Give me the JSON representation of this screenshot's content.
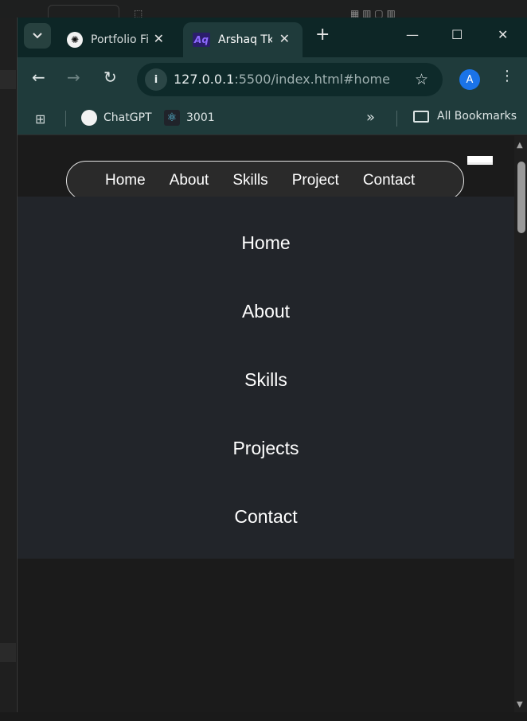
{
  "tabs": [
    {
      "title": "Portfolio Fi",
      "favicon": "chatgpt-icon",
      "active": false
    },
    {
      "title": "Arshaq Tk",
      "favicon_text": "Aq",
      "active": true
    }
  ],
  "toolbar": {
    "url_host": "127.0.0.1",
    "url_rest": ":5500/index.html#home",
    "profile_initial": "A"
  },
  "bookmarks": {
    "items": [
      {
        "label": "ChatGPT",
        "icon": "chatgpt-icon"
      },
      {
        "label": "3001",
        "icon": "react-icon"
      }
    ],
    "all_bookmarks": "All Bookmarks"
  },
  "page": {
    "navbar": [
      "Home",
      "About",
      "Skills",
      "Project",
      "Contact"
    ],
    "menu": [
      "Home",
      "About",
      "Skills",
      "Projects",
      "Contact"
    ]
  },
  "colors": {
    "tabbar": "#0d2626",
    "toolbar": "#1f3b3b",
    "overlay": "#22252a",
    "page_bg": "#1b1b1b"
  }
}
